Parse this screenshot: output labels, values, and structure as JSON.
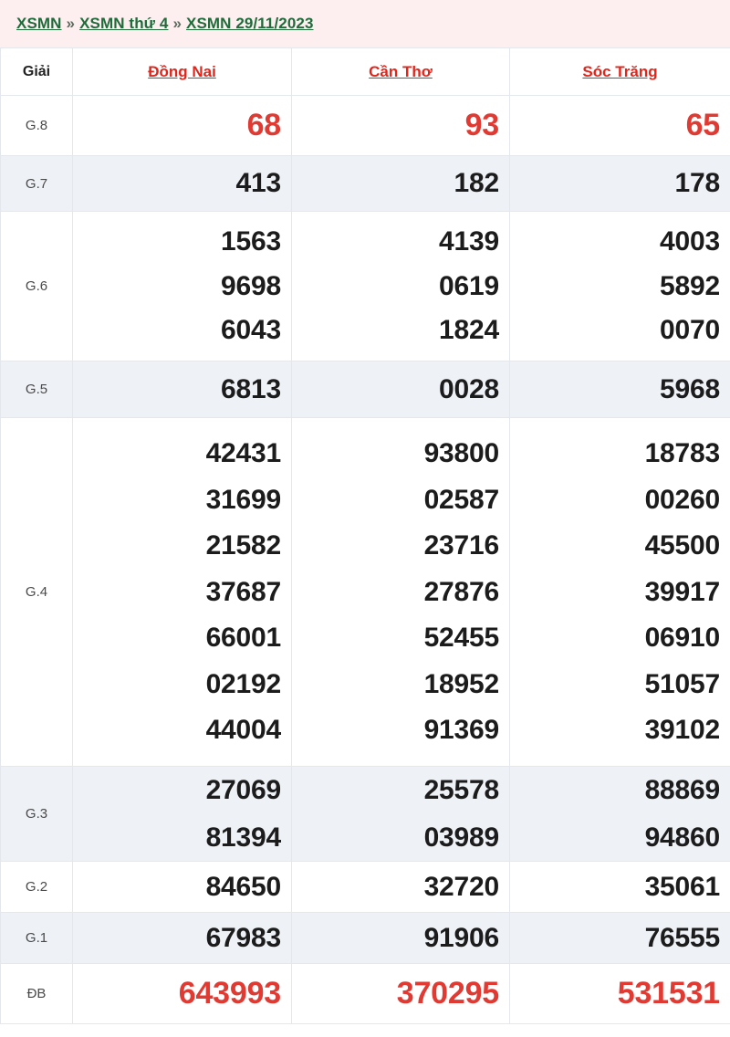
{
  "breadcrumb": {
    "separator": "»",
    "items": [
      {
        "label": "XSMN"
      },
      {
        "label": "XSMN thứ 4"
      },
      {
        "label": "XSMN 29/11/2023"
      }
    ]
  },
  "colors": {
    "banner_bg": "#fdeef0",
    "breadcrumb_link": "#1f6b3a",
    "province_link": "#e1251b",
    "accent_red": "#e03a33",
    "stripe_bg": "#eef1f6",
    "border": "#e4e7ec",
    "number": "#1c1c1c"
  },
  "table": {
    "headers": {
      "prize": "Giải",
      "provinces": [
        {
          "name": "Đồng Nai"
        },
        {
          "name": "Cần Thơ"
        },
        {
          "name": "Sóc Trăng"
        }
      ]
    },
    "rows": [
      {
        "prize": "G.8",
        "striped": false,
        "accent": true,
        "values": {
          "dong_nai": [
            "68"
          ],
          "can_tho": [
            "93"
          ],
          "soc_trang": [
            "65"
          ]
        }
      },
      {
        "prize": "G.7",
        "striped": true,
        "accent": false,
        "values": {
          "dong_nai": [
            "413"
          ],
          "can_tho": [
            "182"
          ],
          "soc_trang": [
            "178"
          ]
        }
      },
      {
        "prize": "G.6",
        "striped": false,
        "accent": false,
        "values": {
          "dong_nai": [
            "1563",
            "9698",
            "6043"
          ],
          "can_tho": [
            "4139",
            "0619",
            "1824"
          ],
          "soc_trang": [
            "4003",
            "5892",
            "0070"
          ]
        }
      },
      {
        "prize": "G.5",
        "striped": true,
        "accent": false,
        "values": {
          "dong_nai": [
            "6813"
          ],
          "can_tho": [
            "0028"
          ],
          "soc_trang": [
            "5968"
          ]
        }
      },
      {
        "prize": "G.4",
        "striped": false,
        "accent": false,
        "values": {
          "dong_nai": [
            "42431",
            "31699",
            "21582",
            "37687",
            "66001",
            "02192",
            "44004"
          ],
          "can_tho": [
            "93800",
            "02587",
            "23716",
            "27876",
            "52455",
            "18952",
            "91369"
          ],
          "soc_trang": [
            "18783",
            "00260",
            "45500",
            "39917",
            "06910",
            "51057",
            "39102"
          ]
        }
      },
      {
        "prize": "G.3",
        "striped": true,
        "accent": false,
        "values": {
          "dong_nai": [
            "27069",
            "81394"
          ],
          "can_tho": [
            "25578",
            "03989"
          ],
          "soc_trang": [
            "88869",
            "94860"
          ]
        }
      },
      {
        "prize": "G.2",
        "striped": false,
        "accent": false,
        "values": {
          "dong_nai": [
            "84650"
          ],
          "can_tho": [
            "32720"
          ],
          "soc_trang": [
            "35061"
          ]
        }
      },
      {
        "prize": "G.1",
        "striped": true,
        "accent": false,
        "values": {
          "dong_nai": [
            "67983"
          ],
          "can_tho": [
            "91906"
          ],
          "soc_trang": [
            "76555"
          ]
        }
      },
      {
        "prize": "ĐB",
        "striped": false,
        "accent": true,
        "values": {
          "dong_nai": [
            "643993"
          ],
          "can_tho": [
            "370295"
          ],
          "soc_trang": [
            "531531"
          ]
        }
      }
    ]
  }
}
